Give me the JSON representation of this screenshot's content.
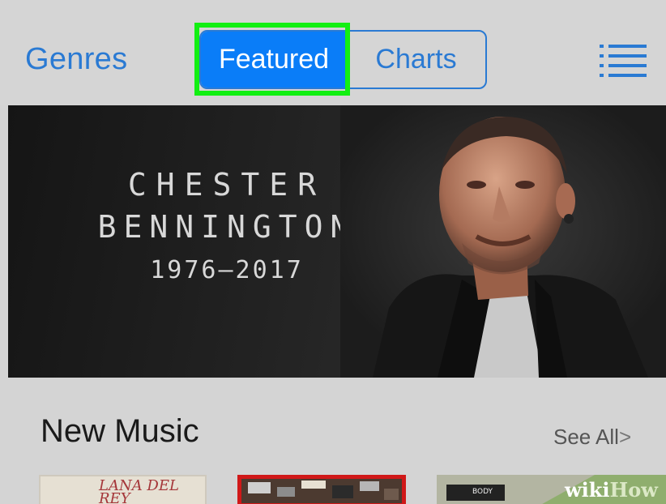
{
  "nav": {
    "genres_label": "Genres",
    "segments": [
      {
        "label": "Featured",
        "selected": true
      },
      {
        "label": "Charts",
        "selected": false
      }
    ],
    "list_icon": "list-icon"
  },
  "banner": {
    "line1": "CHESTER",
    "line2": "BENNINGTON",
    "line3": "1976–2017"
  },
  "section": {
    "title": "New Music",
    "see_all": "See All",
    "see_all_chevron": ">"
  },
  "albums": [
    {
      "cover_text": "LANA DEL REY"
    },
    {
      "cover_text": ""
    },
    {
      "cover_text": "BODY"
    }
  ],
  "watermark": {
    "part1": "wiki",
    "part2": "How"
  },
  "colors": {
    "accent": "#2a7ad3",
    "selected_segment": "#0a7df8",
    "highlight_box": "#12ef12",
    "album_highlight": "#d01818"
  }
}
